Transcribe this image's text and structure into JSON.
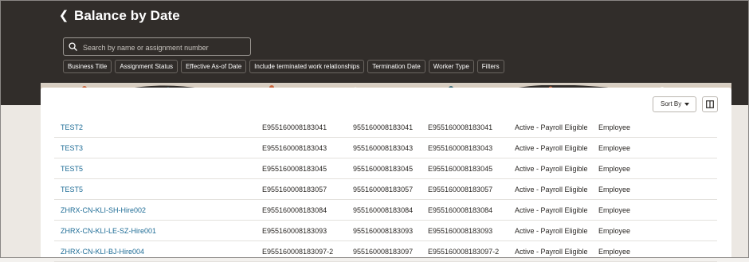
{
  "page": {
    "title": "Balance by Date",
    "back_icon": "chevron-left-icon"
  },
  "search": {
    "placeholder": "Search by name or assignment number",
    "value": "",
    "icon": "search-icon"
  },
  "filters": [
    "Business Title",
    "Assignment Status",
    "Effective As-of Date",
    "Include terminated work relationships",
    "Termination Date",
    "Worker Type",
    "Filters"
  ],
  "toolbar": {
    "sort_label": "Sort By",
    "sort_icon": "caret-down-icon",
    "columns_icon": "column-layout-icon"
  },
  "rows": [
    {
      "name": "TEST2",
      "a": "E955160008183041",
      "b": "955160008183041",
      "c": "E955160008183041",
      "status": "Active - Payroll Eligible",
      "type": "Employee"
    },
    {
      "name": "TEST3",
      "a": "E955160008183043",
      "b": "955160008183043",
      "c": "E955160008183043",
      "status": "Active - Payroll Eligible",
      "type": "Employee"
    },
    {
      "name": "TEST5",
      "a": "E955160008183045",
      "b": "955160008183045",
      "c": "E955160008183045",
      "status": "Active - Payroll Eligible",
      "type": "Employee"
    },
    {
      "name": "TEST5",
      "a": "E955160008183057",
      "b": "955160008183057",
      "c": "E955160008183057",
      "status": "Active - Payroll Eligible",
      "type": "Employee"
    },
    {
      "name": "ZHRX-CN-KLI-SH-Hire002",
      "a": "E955160008183084",
      "b": "955160008183084",
      "c": "E955160008183084",
      "status": "Active - Payroll Eligible",
      "type": "Employee"
    },
    {
      "name": "ZHRX-CN-KLI-LE-SZ-Hire001",
      "a": "E955160008183093",
      "b": "955160008183093",
      "c": "E955160008183093",
      "status": "Active - Payroll Eligible",
      "type": "Employee"
    },
    {
      "name": "ZHRX-CN-KLI-BJ-Hire004",
      "a": "E955160008183097-2",
      "b": "955160008183097",
      "c": "E955160008183097-2",
      "status": "Active - Payroll Eligible",
      "type": "Employee"
    }
  ],
  "colors": {
    "header_bg": "#312d2a",
    "link": "#1e6c96",
    "text": "#2b2825"
  }
}
